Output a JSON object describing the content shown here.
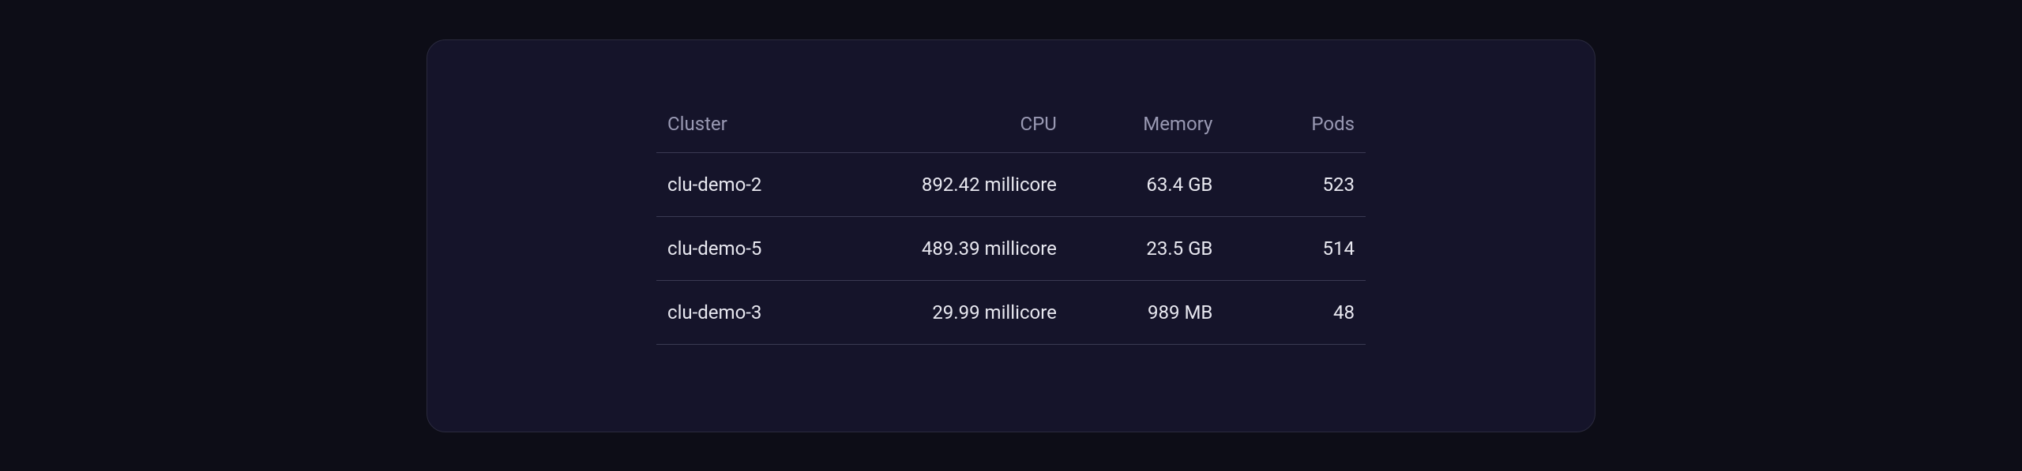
{
  "table": {
    "headers": {
      "cluster": "Cluster",
      "cpu": "CPU",
      "memory": "Memory",
      "pods": "Pods"
    },
    "rows": [
      {
        "cluster": "clu-demo-2",
        "cpu": "892.42 millicore",
        "memory": "63.4 GB",
        "pods": "523"
      },
      {
        "cluster": "clu-demo-5",
        "cpu": "489.39 millicore",
        "memory": "23.5 GB",
        "pods": "514"
      },
      {
        "cluster": "clu-demo-3",
        "cpu": "29.99 millicore",
        "memory": "989 MB",
        "pods": "48"
      }
    ]
  }
}
